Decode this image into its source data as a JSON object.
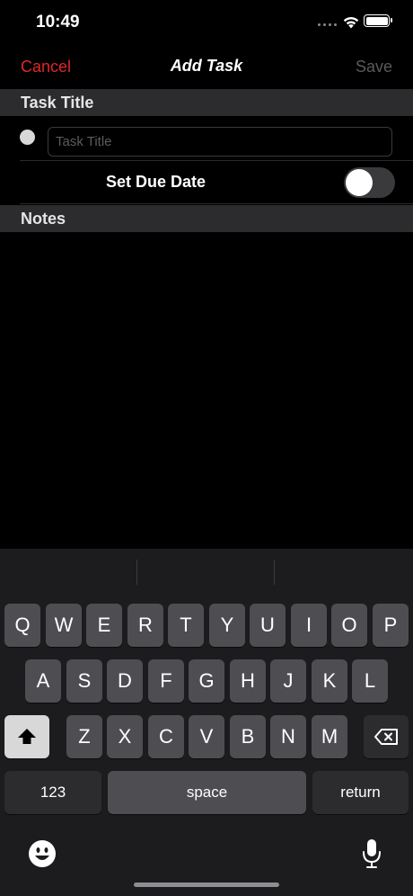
{
  "status_bar": {
    "time": "10:49"
  },
  "nav": {
    "cancel_label": "Cancel",
    "title": "Add Task",
    "save_label": "Save"
  },
  "sections": {
    "task_title_header": "Task Title",
    "notes_header": "Notes"
  },
  "form": {
    "title_placeholder": "Task Title",
    "title_value": "",
    "due_date_label": "Set Due Date",
    "due_date_enabled": false
  },
  "keyboard": {
    "row1": [
      "Q",
      "W",
      "E",
      "R",
      "T",
      "Y",
      "U",
      "I",
      "O",
      "P"
    ],
    "row2": [
      "A",
      "S",
      "D",
      "F",
      "G",
      "H",
      "J",
      "K",
      "L"
    ],
    "row3": [
      "Z",
      "X",
      "C",
      "V",
      "B",
      "N",
      "M"
    ],
    "numbers_label": "123",
    "space_label": "space",
    "return_label": "return"
  },
  "icons": [
    "wifi-icon",
    "battery-icon",
    "shift-icon",
    "backspace-icon",
    "emoji-icon",
    "microphone-icon"
  ],
  "colors": {
    "accent": "#e0262b",
    "background": "#000000",
    "section_header": "#2c2c2e"
  }
}
